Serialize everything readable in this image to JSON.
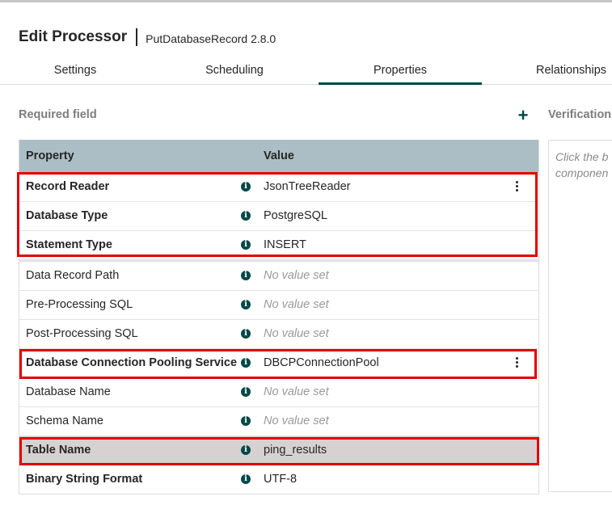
{
  "header": {
    "title": "Edit Processor",
    "subtitle": "PutDatabaseRecord 2.8.0"
  },
  "tabs": [
    {
      "label": "Settings",
      "active": false
    },
    {
      "label": "Scheduling",
      "active": false
    },
    {
      "label": "Properties",
      "active": true
    },
    {
      "label": "Relationships",
      "active": false
    }
  ],
  "properties_panel": {
    "required_label": "Required field",
    "add_icon": "plus-icon",
    "columns": {
      "property": "Property",
      "value": "Value"
    },
    "rows": [
      {
        "property": "Record Reader",
        "value": "JsonTreeReader",
        "required": true,
        "empty": false,
        "kebab": true
      },
      {
        "property": "Database Type",
        "value": "PostgreSQL",
        "required": true,
        "empty": false,
        "kebab": false
      },
      {
        "property": "Statement Type",
        "value": "INSERT",
        "required": true,
        "empty": false,
        "kebab": false
      },
      {
        "property": "Data Record Path",
        "value": "No value set",
        "required": false,
        "empty": true,
        "kebab": false
      },
      {
        "property": "Pre-Processing SQL",
        "value": "No value set",
        "required": false,
        "empty": true,
        "kebab": false
      },
      {
        "property": "Post-Processing SQL",
        "value": "No value set",
        "required": false,
        "empty": true,
        "kebab": false
      },
      {
        "property": "Database Connection Pooling Service",
        "value": "DBCPConnectionPool",
        "required": true,
        "empty": false,
        "kebab": true
      },
      {
        "property": "Database Name",
        "value": "No value set",
        "required": false,
        "empty": true,
        "kebab": false
      },
      {
        "property": "Schema Name",
        "value": "No value set",
        "required": false,
        "empty": true,
        "kebab": false
      },
      {
        "property": "Table Name",
        "value": "ping_results",
        "required": true,
        "empty": false,
        "kebab": false,
        "selected": true
      },
      {
        "property": "Binary String Format",
        "value": "UTF-8",
        "required": true,
        "empty": false,
        "kebab": false
      }
    ]
  },
  "verification": {
    "label": "Verification",
    "hint_line1": "Click the b",
    "hint_line2": "componen"
  },
  "colors": {
    "accent": "#004849",
    "table_header": "#abbdc5",
    "selected_row": "#d7d1d1",
    "highlight_box": "#e00000"
  }
}
